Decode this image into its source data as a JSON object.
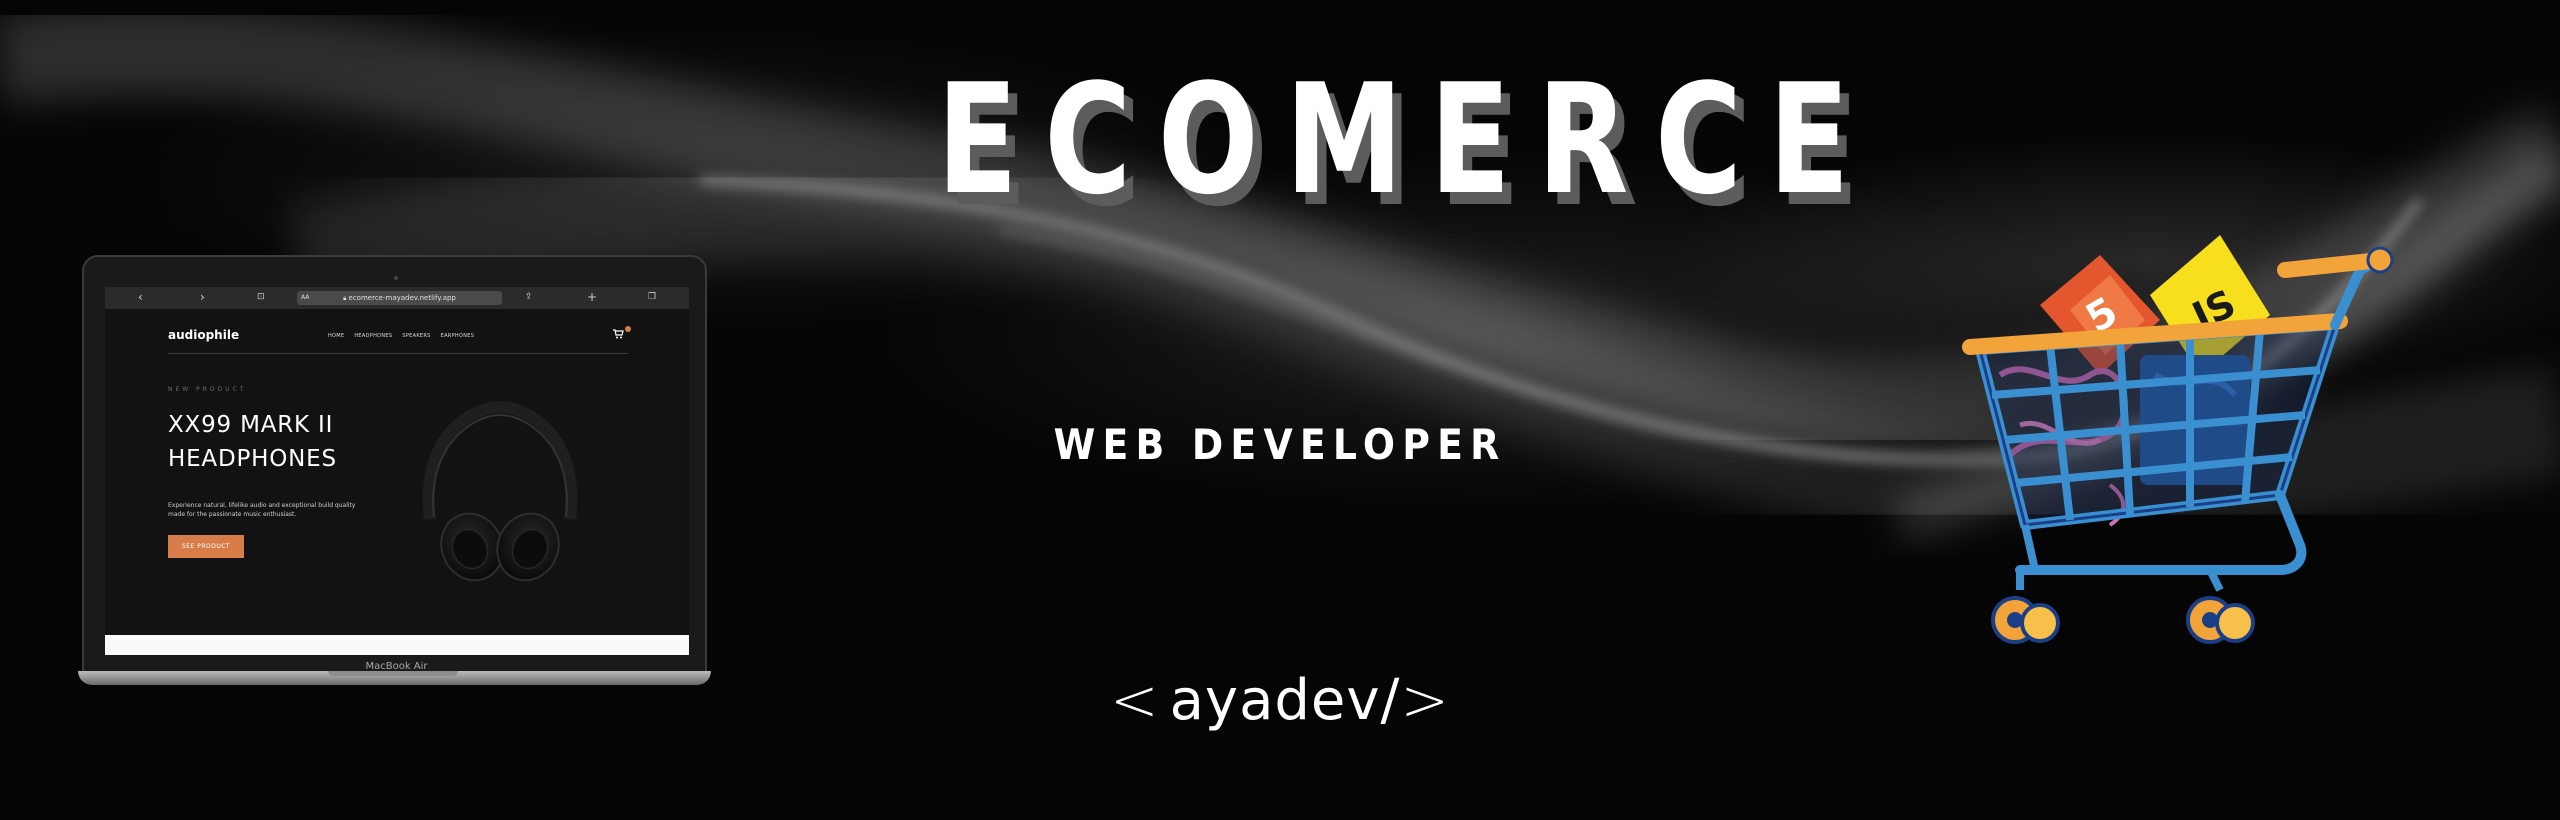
{
  "banner": {
    "headline": "ECOMERCE",
    "subheadline": "WEB DEVELOPER",
    "brand": {
      "left_angle": "<",
      "name": "ayadev/",
      "right_angle": ">"
    }
  },
  "laptop": {
    "model_label": "MacBook Air",
    "browser": {
      "url": "ecomerce-mayadev.netlify.app",
      "text_size_label": "AA",
      "back_icon": "chevron-left-icon",
      "forward_icon": "chevron-right-icon"
    },
    "site": {
      "logo": "audiophile",
      "nav": [
        "HOME",
        "HEADPHONES",
        "SPEAKERS",
        "EARPHONES"
      ],
      "cart_icon": "cart-icon",
      "eyebrow": "NEW PRODUCT",
      "title_line1": "XX99 MARK II",
      "title_line2": "HEADPHONES",
      "description": "Experience natural, lifelike audio and exceptional build quality made for the passionate music enthusiast.",
      "cta": "SEE PRODUCT"
    }
  },
  "colors": {
    "background": "#050505",
    "accent": "#d87d4a",
    "cart_blue": "#3a8fd0",
    "cart_orange": "#f2a33a"
  }
}
